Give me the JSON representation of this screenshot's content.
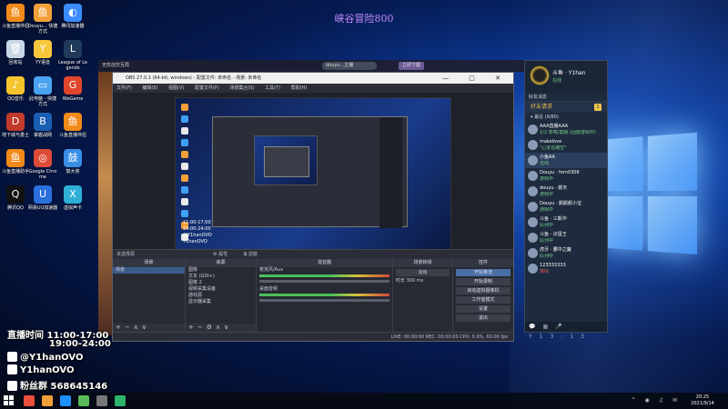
{
  "overlay_title": "峡谷冒险800",
  "desktop_icons": [
    {
      "label": "斗鱼直播伴侣",
      "color": "#f28a1a",
      "glyph": "鱼"
    },
    {
      "label": "Douyu... 快捷方式",
      "color": "#f3a03a",
      "glyph": "鱼"
    },
    {
      "label": "腾讯加速器",
      "color": "#3b8cff",
      "glyph": "◐"
    },
    {
      "label": "回收站",
      "color": "#c9d6e6",
      "glyph": "🗑"
    },
    {
      "label": "YY语音",
      "color": "#f6c63b",
      "glyph": "Y"
    },
    {
      "label": "League of Legends",
      "color": "#1f3a5a",
      "glyph": "L"
    },
    {
      "label": "QQ音乐",
      "color": "#f5c42c",
      "glyph": "♪"
    },
    {
      "label": "此电脑 - 快捷方式",
      "color": "#4aa3f0",
      "glyph": "▭"
    },
    {
      "label": "WeGame",
      "color": "#e0452b",
      "glyph": "G"
    },
    {
      "label": "地下城与勇士",
      "color": "#c23a2b",
      "glyph": "D"
    },
    {
      "label": "掌握战网",
      "color": "#1a5fb4",
      "glyph": "B"
    },
    {
      "label": "斗鱼直播伴侣",
      "color": "#f28a1a",
      "glyph": "鱼"
    },
    {
      "label": "斗鱼直播助手",
      "color": "#f28a1a",
      "glyph": "鱼"
    },
    {
      "label": "Google Chrome",
      "color": "#dd4b39",
      "glyph": "◎"
    },
    {
      "label": "鼓大侠",
      "color": "#3a8ee6",
      "glyph": "鼓"
    },
    {
      "label": "腾讯QQ",
      "color": "#111",
      "glyph": "Q"
    },
    {
      "label": "网易UU加速器",
      "color": "#2a6fdb",
      "glyph": "U"
    },
    {
      "label": "虚拟声卡",
      "color": "#2fb0d6",
      "glyph": "X"
    }
  ],
  "douyu": {
    "title": "无忧创交互局",
    "address": "douyu...主播",
    "button": "立即下载"
  },
  "obs": {
    "title": "OBS 27.0.1 (64-bit, windows) - 配置文件: 未命名 - 场景: 未命名",
    "menu": [
      "文件(F)",
      "编辑(E)",
      "视图(V)",
      "配置文件(P)",
      "场景集合(S)",
      "工具(T)",
      "帮助(H)"
    ],
    "preview_caption_lines": [
      "11:00-17:00",
      "19:00-24:00",
      "@Y1hanOVO",
      "Y1hanOVO"
    ],
    "toolbar_label": "未选择源",
    "toolbar_buttons": [
      "属性",
      "滤镜"
    ],
    "docks": {
      "scenes": {
        "title": "场景",
        "items": [
          "场景"
        ]
      },
      "sources": {
        "title": "来源",
        "items": [
          "图像",
          "文本 (GDI+)",
          "图像 2",
          "视频采集设备",
          "游戏源",
          "显示器采集"
        ]
      },
      "mixer": {
        "title": "混音器",
        "tracks": [
          {
            "name": "麦克风/Aux",
            "level": 0.7
          },
          {
            "name": "桌面音频",
            "level": 0.75
          }
        ]
      },
      "transitions": {
        "title": "场景转场",
        "type": "淡出",
        "duration_label": "时长",
        "duration": "300 ms"
      },
      "controls": {
        "title": "控件",
        "buttons": [
          "开始推流",
          "开始录制",
          "启动虚拟摄像机",
          "工作室模式",
          "设置",
          "退出"
        ]
      }
    },
    "status": "LIVE: 00:00:00    REC: 00:00:00    CPU: 0.9%, 60.00 fps"
  },
  "streamer": {
    "schedule_label": "直播时间",
    "time1": "11:00-17:00",
    "time2": "19:00-24:00",
    "weibo": "@Y1hanOVO",
    "douyin": "Y1hanOVO",
    "fans_label": "粉丝群",
    "fans_group": "568645146"
  },
  "chat": {
    "user_name": "斗鱼 · Y1han",
    "user_status": "在线",
    "tabs": "好友消息",
    "section_title": "好友请求",
    "section_count": "1",
    "group_label": "▾ 最近 (9/80)",
    "friends": [
      {
        "name": "AAA直播AAA",
        "status": "1/2 草莓/莫桃 (回放游戏中)",
        "status_color": "green",
        "highlight": false
      },
      {
        "name": "makelove",
        "status": "\"心爱在路空\"",
        "status_color": "green",
        "highlight": false
      },
      {
        "name": "小鱼AA",
        "status": "在线",
        "status_color": "green",
        "highlight": true
      },
      {
        "name": "Douyu · fern0306",
        "status": "游戏中",
        "status_color": "green",
        "highlight": false
      },
      {
        "name": "douyu · 颜天",
        "status": "游戏中",
        "status_color": "green",
        "highlight": false
      },
      {
        "name": "Douyu · 颜颜颜小宝",
        "status": "游戏中",
        "status_color": "green",
        "highlight": false
      },
      {
        "name": "斗鱼 · 三斯冲",
        "status": "队列中",
        "status_color": "green",
        "highlight": false
      },
      {
        "name": "斗鱼 · 识蛋王",
        "status": "队列中",
        "status_color": "green",
        "highlight": false
      },
      {
        "name": "虎牙 · 腰中之魔",
        "status": "队列中",
        "status_color": "green",
        "highlight": false
      },
      {
        "name": "123333333",
        "status": "离线",
        "status_color": "red",
        "highlight": false
      }
    ],
    "footer_time": "Y13:13"
  },
  "taskbar": {
    "time": "20:25",
    "date": "2021/9/14",
    "apps": [
      "#e94f3b",
      "#f3a03a",
      "#1e90ff",
      "#5bbb5b",
      "#777",
      "#2db36b"
    ]
  }
}
